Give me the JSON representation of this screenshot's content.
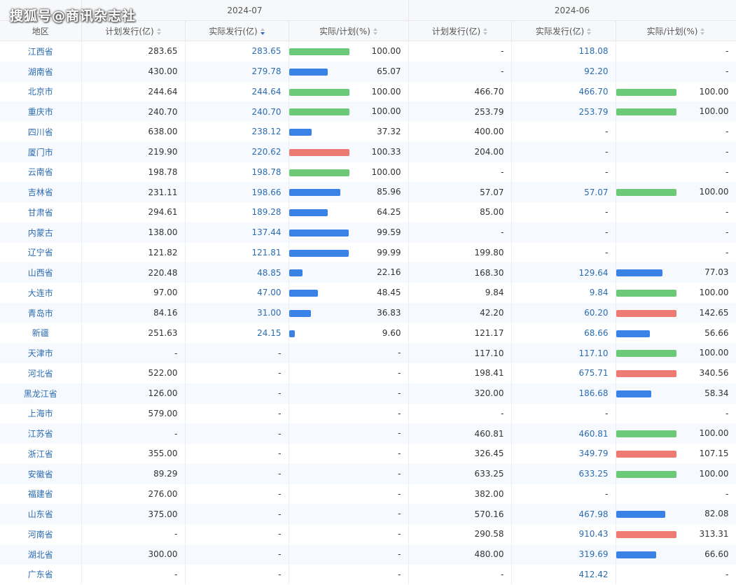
{
  "watermark": "搜狐号@商讯杂志社",
  "header": {
    "group1": "2024-07",
    "group2": "2024-06",
    "region": "地区",
    "planned": "计划发行(亿)",
    "actual": "实际发行(亿)",
    "ratio": "实际/计划(%)"
  },
  "colors": {
    "green": "#6cc977",
    "blue": "#3b82e6",
    "red": "#ee7a74",
    "link": "#2b6cb0"
  },
  "rows": [
    {
      "region": "江西省",
      "jul_plan": "283.65",
      "jul_act": "283.65",
      "jul_ratio": "100.00",
      "jun_plan": "-",
      "jun_act": "118.08",
      "jun_ratio": "-"
    },
    {
      "region": "湖南省",
      "jul_plan": "430.00",
      "jul_act": "279.78",
      "jul_ratio": "65.07",
      "jun_plan": "-",
      "jun_act": "92.20",
      "jun_ratio": "-"
    },
    {
      "region": "北京市",
      "jul_plan": "244.64",
      "jul_act": "244.64",
      "jul_ratio": "100.00",
      "jun_plan": "466.70",
      "jun_act": "466.70",
      "jun_ratio": "100.00"
    },
    {
      "region": "重庆市",
      "jul_plan": "240.70",
      "jul_act": "240.70",
      "jul_ratio": "100.00",
      "jun_plan": "253.79",
      "jun_act": "253.79",
      "jun_ratio": "100.00"
    },
    {
      "region": "四川省",
      "jul_plan": "638.00",
      "jul_act": "238.12",
      "jul_ratio": "37.32",
      "jun_plan": "400.00",
      "jun_act": "-",
      "jun_ratio": "-"
    },
    {
      "region": "厦门市",
      "jul_plan": "219.90",
      "jul_act": "220.62",
      "jul_ratio": "100.33",
      "jun_plan": "204.00",
      "jun_act": "-",
      "jun_ratio": "-"
    },
    {
      "region": "云南省",
      "jul_plan": "198.78",
      "jul_act": "198.78",
      "jul_ratio": "100.00",
      "jun_plan": "-",
      "jun_act": "-",
      "jun_ratio": "-"
    },
    {
      "region": "吉林省",
      "jul_plan": "231.11",
      "jul_act": "198.66",
      "jul_ratio": "85.96",
      "jun_plan": "57.07",
      "jun_act": "57.07",
      "jun_ratio": "100.00"
    },
    {
      "region": "甘肃省",
      "jul_plan": "294.61",
      "jul_act": "189.28",
      "jul_ratio": "64.25",
      "jun_plan": "85.00",
      "jun_act": "-",
      "jun_ratio": "-"
    },
    {
      "region": "内蒙古",
      "jul_plan": "138.00",
      "jul_act": "137.44",
      "jul_ratio": "99.59",
      "jun_plan": "-",
      "jun_act": "-",
      "jun_ratio": "-"
    },
    {
      "region": "辽宁省",
      "jul_plan": "121.82",
      "jul_act": "121.81",
      "jul_ratio": "99.99",
      "jun_plan": "199.80",
      "jun_act": "-",
      "jun_ratio": "-"
    },
    {
      "region": "山西省",
      "jul_plan": "220.48",
      "jul_act": "48.85",
      "jul_ratio": "22.16",
      "jun_plan": "168.30",
      "jun_act": "129.64",
      "jun_ratio": "77.03"
    },
    {
      "region": "大连市",
      "jul_plan": "97.00",
      "jul_act": "47.00",
      "jul_ratio": "48.45",
      "jun_plan": "9.84",
      "jun_act": "9.84",
      "jun_ratio": "100.00"
    },
    {
      "region": "青岛市",
      "jul_plan": "84.16",
      "jul_act": "31.00",
      "jul_ratio": "36.83",
      "jun_plan": "42.20",
      "jun_act": "60.20",
      "jun_ratio": "142.65"
    },
    {
      "region": "新疆",
      "jul_plan": "251.63",
      "jul_act": "24.15",
      "jul_ratio": "9.60",
      "jun_plan": "121.17",
      "jun_act": "68.66",
      "jun_ratio": "56.66"
    },
    {
      "region": "天津市",
      "jul_plan": "-",
      "jul_act": "-",
      "jul_ratio": "-",
      "jun_plan": "117.10",
      "jun_act": "117.10",
      "jun_ratio": "100.00"
    },
    {
      "region": "河北省",
      "jul_plan": "522.00",
      "jul_act": "-",
      "jul_ratio": "-",
      "jun_plan": "198.41",
      "jun_act": "675.71",
      "jun_ratio": "340.56"
    },
    {
      "region": "黑龙江省",
      "jul_plan": "126.00",
      "jul_act": "-",
      "jul_ratio": "-",
      "jun_plan": "320.00",
      "jun_act": "186.68",
      "jun_ratio": "58.34"
    },
    {
      "region": "上海市",
      "jul_plan": "579.00",
      "jul_act": "-",
      "jul_ratio": "-",
      "jun_plan": "-",
      "jun_act": "-",
      "jun_ratio": "-"
    },
    {
      "region": "江苏省",
      "jul_plan": "-",
      "jul_act": "-",
      "jul_ratio": "-",
      "jun_plan": "460.81",
      "jun_act": "460.81",
      "jun_ratio": "100.00"
    },
    {
      "region": "浙江省",
      "jul_plan": "355.00",
      "jul_act": "-",
      "jul_ratio": "-",
      "jun_plan": "326.45",
      "jun_act": "349.79",
      "jun_ratio": "107.15"
    },
    {
      "region": "安徽省",
      "jul_plan": "89.29",
      "jul_act": "-",
      "jul_ratio": "-",
      "jun_plan": "633.25",
      "jun_act": "633.25",
      "jun_ratio": "100.00"
    },
    {
      "region": "福建省",
      "jul_plan": "276.00",
      "jul_act": "-",
      "jul_ratio": "-",
      "jun_plan": "382.00",
      "jun_act": "-",
      "jun_ratio": "-"
    },
    {
      "region": "山东省",
      "jul_plan": "375.00",
      "jul_act": "-",
      "jul_ratio": "-",
      "jun_plan": "570.16",
      "jun_act": "467.98",
      "jun_ratio": "82.08"
    },
    {
      "region": "河南省",
      "jul_plan": "-",
      "jul_act": "-",
      "jul_ratio": "-",
      "jun_plan": "290.58",
      "jun_act": "910.43",
      "jun_ratio": "313.31"
    },
    {
      "region": "湖北省",
      "jul_plan": "300.00",
      "jul_act": "-",
      "jul_ratio": "-",
      "jun_plan": "480.00",
      "jun_act": "319.69",
      "jun_ratio": "66.60"
    },
    {
      "region": "广东省",
      "jul_plan": "-",
      "jul_act": "-",
      "jul_ratio": "-",
      "jun_plan": "-",
      "jun_act": "412.42",
      "jun_ratio": "-"
    }
  ]
}
